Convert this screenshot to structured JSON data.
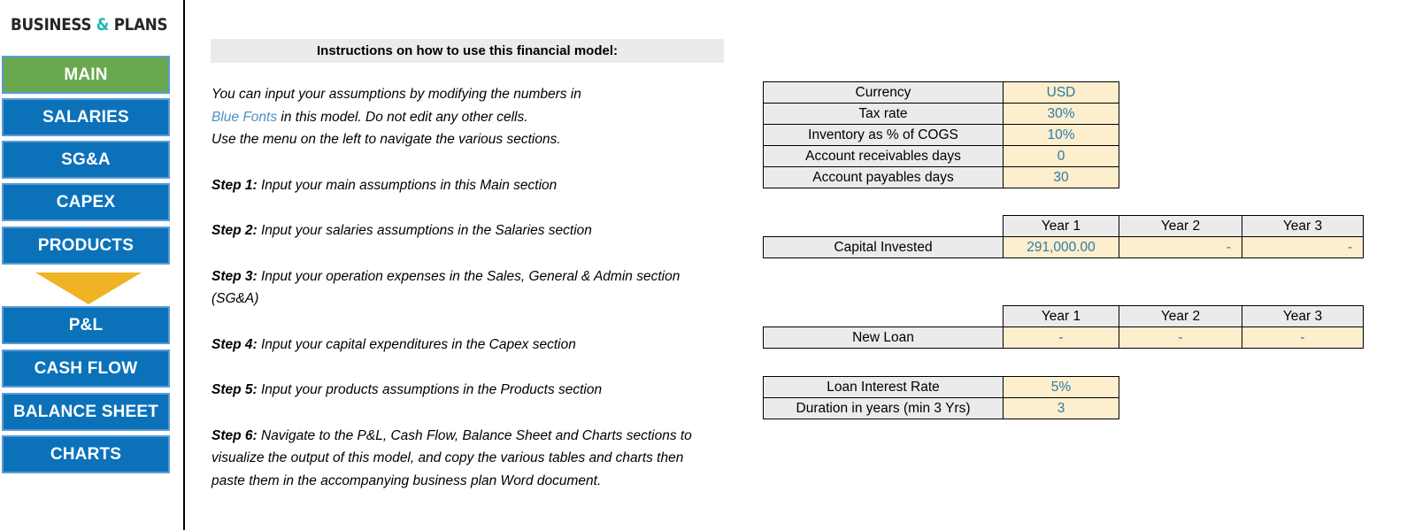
{
  "sidebar": {
    "logo": {
      "text_part1": "BUSINESS",
      "amp": "&",
      "text_part2": "PLANS"
    },
    "arrow_icon": "down-arrow-icon",
    "items": [
      {
        "label": "MAIN",
        "active": true
      },
      {
        "label": "SALARIES",
        "active": false
      },
      {
        "label": "SG&A",
        "active": false
      },
      {
        "label": "CAPEX",
        "active": false
      },
      {
        "label": "PRODUCTS",
        "active": false
      },
      {
        "label": "P&L",
        "active": false
      },
      {
        "label": "CASH FLOW",
        "active": false
      },
      {
        "label": "BALANCE SHEET",
        "active": false
      },
      {
        "label": "CHARTS",
        "active": false
      }
    ]
  },
  "instructions": {
    "header": "Instructions on how to use this financial model:",
    "intro_line1": "You can input your assumptions by modifying the numbers in",
    "intro_blue": "Blue Fonts",
    "intro_line2_rest": " in this model. Do not edit any other cells.",
    "intro_line3": "Use the menu on the left to navigate the various sections.",
    "steps": [
      {
        "label": "Step 1:",
        "text": " Input your main assumptions in this Main section"
      },
      {
        "label": "Step 2:",
        "text": " Input your salaries assumptions in the Salaries section"
      },
      {
        "label": "Step 3:",
        "text": " Input your operation expenses in the Sales, General & Admin section (SG&A)"
      },
      {
        "label": "Step 4:",
        "text": " Input your capital expenditures in the Capex section"
      },
      {
        "label": "Step 5:",
        "text": " Input your products assumptions in the Products section"
      },
      {
        "label": "Step 6:",
        "text": " Navigate to the P&L, Cash Flow, Balance Sheet and Charts sections to visualize the output of this model, and copy the various tables and charts then paste them in the accompanying business plan Word document."
      }
    ]
  },
  "assumptions_table": {
    "rows": [
      {
        "label": "Currency",
        "value": "USD"
      },
      {
        "label": "Tax rate",
        "value": "30%"
      },
      {
        "label": "Inventory as % of COGS",
        "value": "10%"
      },
      {
        "label": "Account receivables days",
        "value": "0"
      },
      {
        "label": "Account payables days",
        "value": "30"
      }
    ]
  },
  "capital_table": {
    "headers": [
      "Year 1",
      "Year 2",
      "Year 3"
    ],
    "row_label": "Capital Invested",
    "values": [
      "291,000.00",
      "-",
      "-"
    ]
  },
  "loan_table": {
    "headers": [
      "Year 1",
      "Year 2",
      "Year 3"
    ],
    "row_label": "New Loan",
    "values": [
      "-",
      "-",
      "-"
    ]
  },
  "loan_terms_table": {
    "rows": [
      {
        "label": "Loan Interest Rate",
        "value": "5%"
      },
      {
        "label": "Duration in years (min 3 Yrs)",
        "value": "3"
      }
    ]
  },
  "colors": {
    "nav_blue": "#0b72ba",
    "nav_border": "#5b9bd5",
    "nav_active_green": "#6aa84f",
    "arrow_orange": "#f0b323",
    "input_blue_text": "#2b7ba8",
    "input_cell_bg": "#fdeecd",
    "label_cell_bg": "#ebebeb",
    "logo_amp_teal": "#24b7b0"
  }
}
